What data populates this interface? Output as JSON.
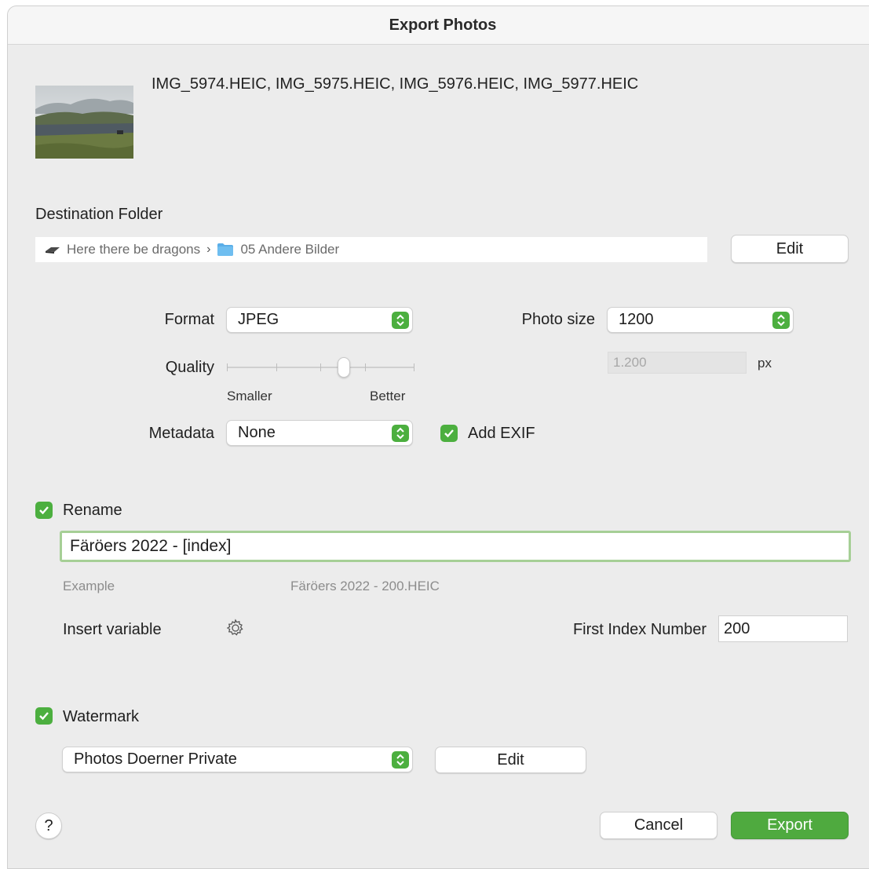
{
  "window": {
    "title": "Export Photos"
  },
  "files": {
    "names": "IMG_5974.HEIC, IMG_5975.HEIC, IMG_5976.HEIC, IMG_5977.HEIC"
  },
  "destination": {
    "label": "Destination Folder",
    "volume": "Here there be dragons",
    "folder": "05 Andere Bilder",
    "edit_label": "Edit"
  },
  "format": {
    "label": "Format",
    "value": "JPEG"
  },
  "photo_size": {
    "label": "Photo size",
    "value": "1200",
    "px_value": "1.200",
    "unit": "px"
  },
  "quality": {
    "label": "Quality",
    "min_label": "Smaller",
    "max_label": "Better",
    "level": 0.625
  },
  "metadata": {
    "label": "Metadata",
    "value": "None",
    "exif_label": "Add EXIF",
    "exif_checked": true
  },
  "rename": {
    "label": "Rename",
    "checked": true,
    "pattern": "Färöers 2022 - [index]",
    "example_label": "Example",
    "example_value": "Färöers 2022 - 200.HEIC",
    "insert_variable_label": "Insert variable",
    "first_index_label": "First Index Number",
    "first_index_value": "200"
  },
  "watermark": {
    "label": "Watermark",
    "checked": true,
    "preset": "Photos Doerner Private",
    "edit_label": "Edit"
  },
  "footer": {
    "help": "?",
    "cancel_label": "Cancel",
    "export_label": "Export"
  },
  "colors": {
    "accent": "#4caf3f",
    "focus_ring": "#a6cf96"
  },
  "icons": {
    "volume": "drive-icon",
    "folder": "folder-icon",
    "chevron": "chevron-right-icon",
    "stepper": "updown-chevron-icon",
    "gear": "gear-icon",
    "check": "checkmark-icon"
  }
}
